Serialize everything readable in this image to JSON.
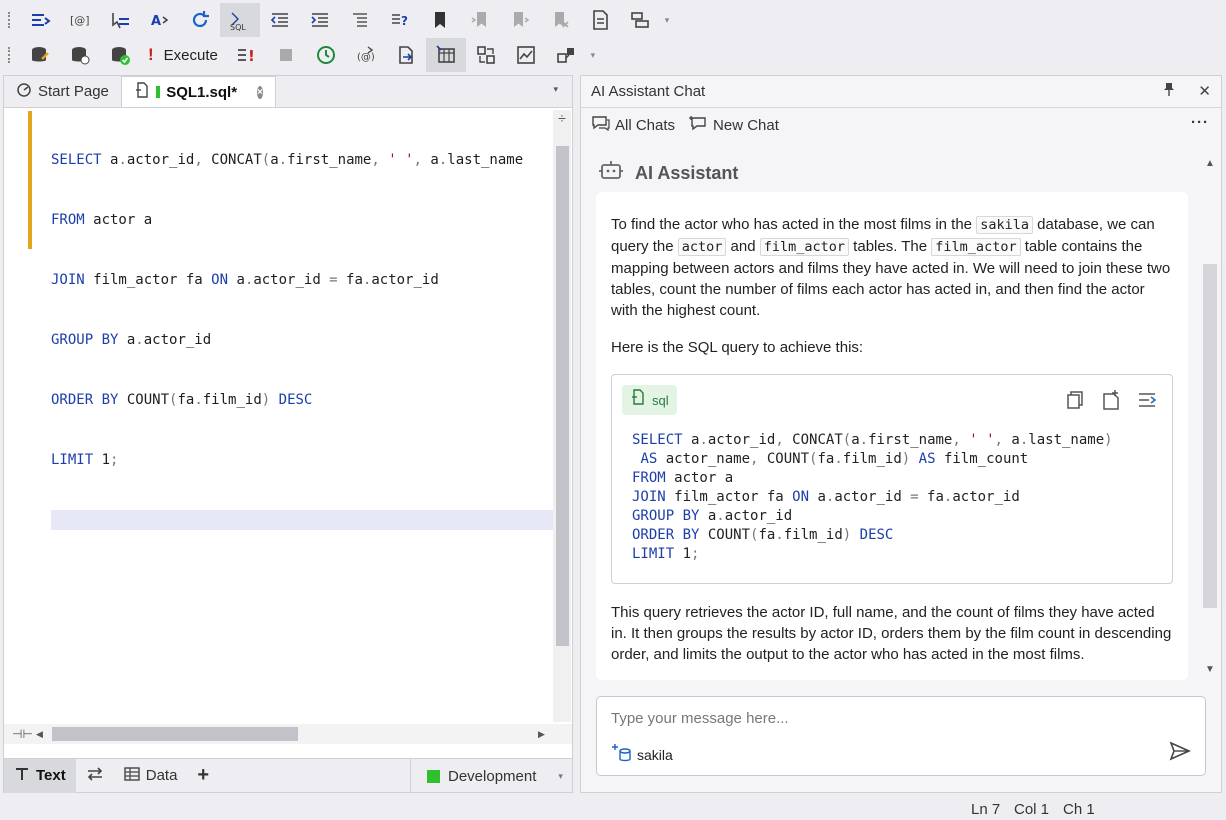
{
  "toolbar2": {
    "execute_label": "Execute"
  },
  "tabs": [
    {
      "label": "Start Page"
    },
    {
      "label": "SQL1.sql*"
    }
  ],
  "editor": {
    "lines": [
      "SELECT a.actor_id, CONCAT(a.first_name, ' ', a.last_name",
      "FROM actor a",
      "JOIN film_actor fa ON a.actor_id = fa.actor_id",
      "GROUP BY a.actor_id",
      "ORDER BY COUNT(fa.film_id) DESC",
      "LIMIT 1;",
      ""
    ]
  },
  "editor_bottom": {
    "text_tab": "Text",
    "data_tab": "Data",
    "environment": "Development"
  },
  "chat": {
    "title": "AI Assistant Chat",
    "all_chats": "All Chats",
    "new_chat": "New Chat",
    "assistant_name": "AI Assistant",
    "para1": {
      "t1": "To find the actor who has acted in the most films in the ",
      "c1": "sakila",
      "t2": " database, we can query the ",
      "c2": "actor",
      "t3": " and ",
      "c3": "film_actor",
      "t4": " tables. The ",
      "c4": "film_actor",
      "t5": " table contains the mapping between actors and films they have acted in. We will need to join these two tables, count the number of films each actor has acted in, and then find the actor with the highest count."
    },
    "para2": "Here is the SQL query to achieve this:",
    "code_lang": "sql",
    "code_lines": [
      "SELECT a.actor_id, CONCAT(a.first_name, ' ', a.last_name)",
      " AS actor_name, COUNT(fa.film_id) AS film_count",
      "FROM actor a",
      "JOIN film_actor fa ON a.actor_id = fa.actor_id",
      "GROUP BY a.actor_id",
      "ORDER BY COUNT(fa.film_id) DESC",
      "LIMIT 1;"
    ],
    "para3": "This query retrieves the actor ID, full name, and the count of films they have acted in. It then groups the results by actor ID, orders them by the film count in descending order, and limits the output to the actor who has acted in the most films.",
    "input_placeholder": "Type your message here...",
    "db_tag": "sakila"
  },
  "status": {
    "ln": "Ln 7",
    "col": "Col 1",
    "ch": "Ch 1"
  },
  "colors": {
    "keyword": "#1c3ea8",
    "string": "#a31515",
    "modified_bar": "#e3a61f",
    "env_green": "#2ec02e"
  },
  "icons": [
    "comment-icon",
    "sql-format-icon",
    "refresh-icon",
    "bookmark-icon",
    "database-icon",
    "execute-icon",
    "stop-icon",
    "send-icon",
    "copy-icon",
    "pin-icon",
    "close-icon"
  ]
}
